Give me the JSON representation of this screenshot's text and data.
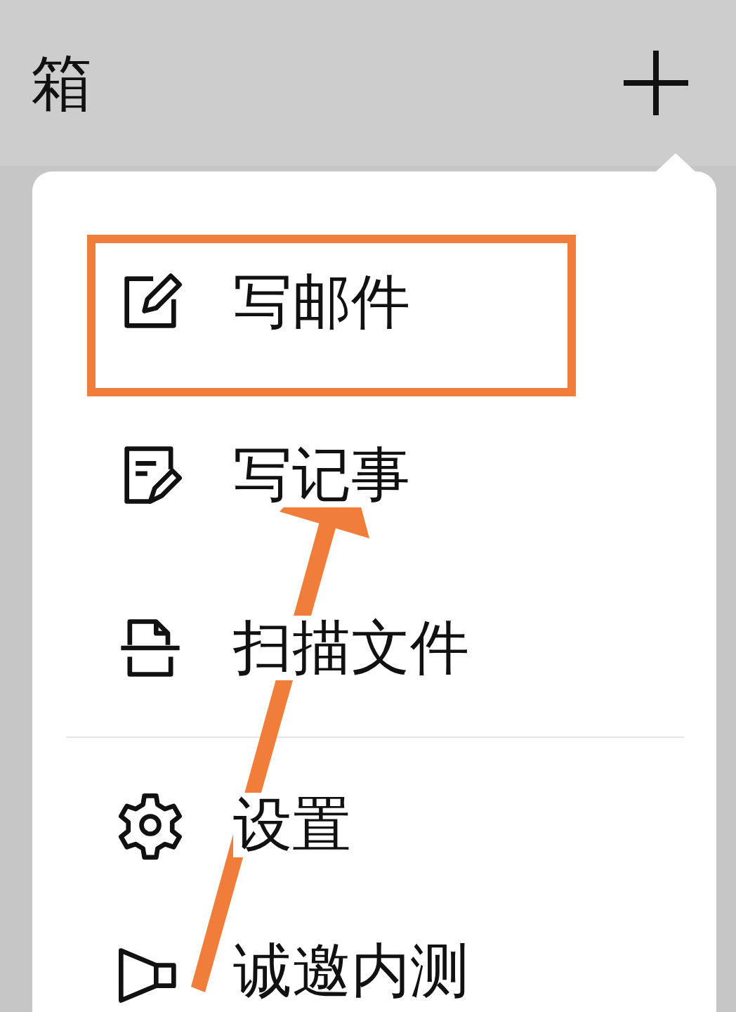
{
  "header": {
    "title": "箱"
  },
  "menu": {
    "items": [
      {
        "label": "写邮件",
        "kind": "compose",
        "highlighted": true,
        "separator_above": false
      },
      {
        "label": "写记事",
        "kind": "note",
        "highlighted": false,
        "separator_above": false
      },
      {
        "label": "扫描文件",
        "kind": "scan",
        "highlighted": false,
        "separator_above": false
      },
      {
        "label": "设置",
        "kind": "settings",
        "highlighted": false,
        "separator_above": true
      },
      {
        "label": "诚邀内测",
        "kind": "megaphone",
        "highlighted": false,
        "separator_above": false
      }
    ]
  }
}
